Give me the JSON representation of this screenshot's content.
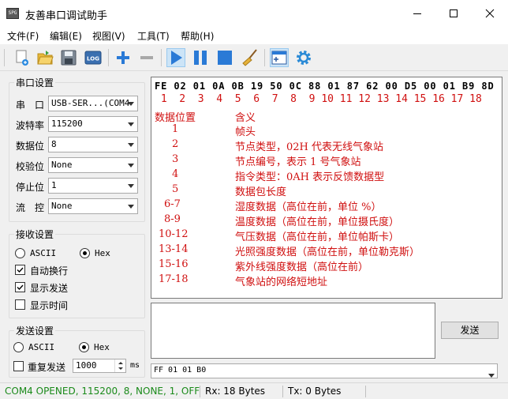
{
  "window": {
    "title": "友善串口调试助手",
    "app_icon_text": "SPG"
  },
  "menu": [
    "文件(F)",
    "编辑(E)",
    "视图(V)",
    "工具(T)",
    "帮助(H)"
  ],
  "toolbar": {
    "log_label": "LOG",
    "buttons": [
      "new-icon",
      "open-icon",
      "save-icon",
      "log-icon",
      "add-icon",
      "remove-icon",
      "play-icon",
      "pause-icon",
      "stop-icon",
      "clear-broom-icon",
      "add-window-icon",
      "settings-gear-icon"
    ]
  },
  "serial_settings": {
    "title": "串口设置",
    "rows": [
      {
        "label": "串　口",
        "value": "USB-SER...(COM4"
      },
      {
        "label": "波特率",
        "value": "115200"
      },
      {
        "label": "数据位",
        "value": "8"
      },
      {
        "label": "校验位",
        "value": "None"
      },
      {
        "label": "停止位",
        "value": "1"
      },
      {
        "label": "流　控",
        "value": "None"
      }
    ]
  },
  "receive_settings": {
    "title": "接收设置",
    "ascii_label": "ASCII",
    "hex_label": "Hex",
    "selected": "Hex",
    "checks": [
      {
        "label": "自动换行",
        "checked": true
      },
      {
        "label": "显示发送",
        "checked": true
      },
      {
        "label": "显示时间",
        "checked": false
      }
    ]
  },
  "send_settings": {
    "title": "发送设置",
    "ascii_label": "ASCII",
    "hex_label": "Hex",
    "selected": "Hex",
    "repeat_label": "重复发送",
    "repeat_checked": false,
    "interval": "1000",
    "unit": "ms"
  },
  "receive_area": {
    "hex": "FE 02 01 0A 0B 19 50 0C 88 01 87 62 00 D5 00 01 B9 8D",
    "index": " 1  2  3  4  5  6  7  8  9 10 11 12 13 14 15 16 17 18",
    "header": {
      "pos": "数据位置",
      "meaning": "含义"
    },
    "rows": [
      {
        "pos": "1",
        "meaning": "帧头"
      },
      {
        "pos": "2",
        "meaning": "节点类型，02H 代表无线气象站"
      },
      {
        "pos": "3",
        "meaning": "节点编号，表示 1 号气象站"
      },
      {
        "pos": "4",
        "meaning": "指令类型：0AH 表示反馈数据型"
      },
      {
        "pos": "5",
        "meaning": "数据包长度"
      },
      {
        "pos": "6-7",
        "meaning": "湿度数据（高位在前，单位 %）"
      },
      {
        "pos": "8-9",
        "meaning": "温度数据（高位在前，单位摄氏度）"
      },
      {
        "pos": "10-12",
        "meaning": "气压数据（高位在前，单位帕斯卡）"
      },
      {
        "pos": "13-14",
        "meaning": "光照强度数据（高位在前，单位勒克斯）"
      },
      {
        "pos": "15-16",
        "meaning": "紫外线强度数据（高位在前）"
      },
      {
        "pos": "17-18",
        "meaning": "气象站的网络短地址"
      }
    ]
  },
  "send_area": {
    "text": "",
    "button": "发送",
    "history_value": "FF 01 01 B0"
  },
  "status": {
    "port": "COM4 OPENED, 115200, 8, NONE, 1, OFF",
    "rx": "Rx: 18 Bytes",
    "tx": "Tx: 0 Bytes",
    "port_color": "#1a8a1a"
  }
}
